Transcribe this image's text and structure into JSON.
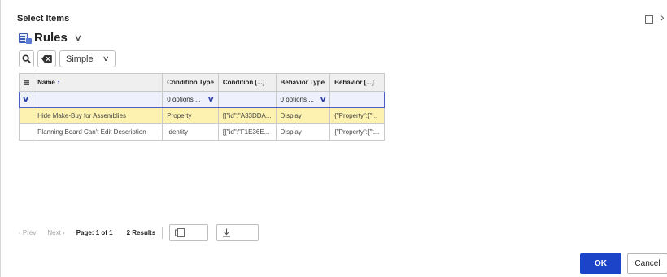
{
  "dialog": {
    "title": "Select Items",
    "controls": {
      "maximize_icon": "maximize-icon",
      "close_glyph": "›"
    }
  },
  "view": {
    "title": "Rules",
    "icon": "rules-view-icon"
  },
  "toolbar": {
    "search_icon": "search-icon",
    "clear_icon": "clear-filter-icon",
    "mode_value": "Simple"
  },
  "grid": {
    "columns": [
      {
        "label": "Name",
        "sorted": "asc"
      },
      {
        "label": "Condition Type"
      },
      {
        "label": "Condition [...]"
      },
      {
        "label": "Behavior Type"
      },
      {
        "label": "Behavior [...]"
      }
    ],
    "filters": {
      "condition_type": "0 options ...",
      "behavior_type": "0 options ..."
    },
    "rows": [
      {
        "name": "Hide Make-Buy for Assemblies",
        "condition_type": "Property",
        "condition": "[{\"id\":\"A33DDA...",
        "behavior_type": "Display",
        "behavior": "{\"Property\":{\"...",
        "selected": true
      },
      {
        "name": "Planning Board Can't Edit Description",
        "condition_type": "Identity",
        "condition": "[{\"id\":\"F1E36E...",
        "behavior_type": "Display",
        "behavior": "{\"Property\":{\"t...",
        "selected": false
      }
    ]
  },
  "pager": {
    "prev": "‹ Prev",
    "next": "Next ›",
    "page_label": "Page: 1 of 1",
    "results_label": "2 Results"
  },
  "footer": {
    "ok_label": "OK",
    "cancel_label": "Cancel"
  },
  "colors": {
    "primary": "#1c44c9",
    "selected_row": "#fdf2b0",
    "filter_accent": "#4a5fc1"
  }
}
